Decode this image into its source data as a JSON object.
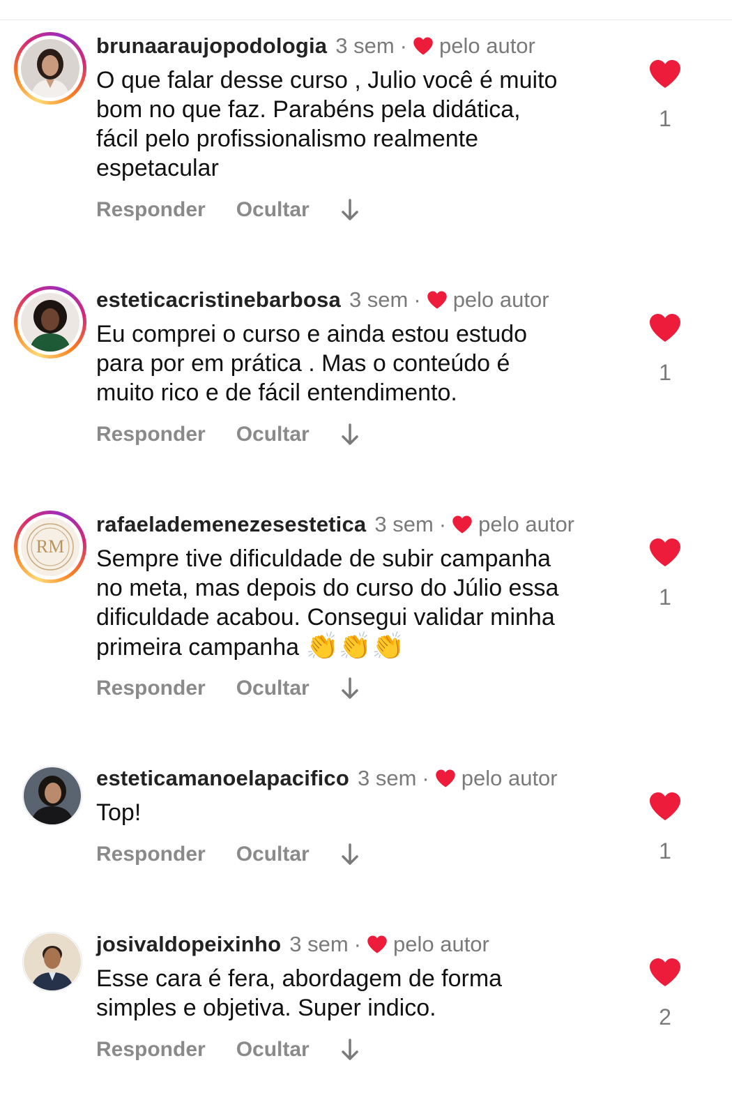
{
  "comments": [
    {
      "username": "brunaaraujopodologia",
      "time": "3 sem",
      "author_label": "pelo autor",
      "lines": [
        "O que falar desse curso , Julio você é muito",
        "bom no que faz. Parabéns pela didática,",
        "fácil pelo profissionalismo realmente",
        "espetacular"
      ],
      "likes": "1",
      "reply_label": "Responder",
      "hide_label": "Ocultar"
    },
    {
      "username": "esteticacristinebarbosa",
      "time": "3 sem",
      "author_label": "pelo autor",
      "lines": [
        "Eu comprei o curso e ainda estou estudo",
        "para por em prática . Mas o conteúdo é",
        "muito rico e de fácil entendimento."
      ],
      "likes": "1",
      "reply_label": "Responder",
      "hide_label": "Ocultar"
    },
    {
      "username": "rafaelademenezesestetica",
      "time": "3 sem",
      "author_label": "pelo autor",
      "lines": [
        "Sempre tive dificuldade de subir campanha",
        "no meta, mas depois do curso do Júlio essa",
        "dificuldade acabou. Consegui validar minha",
        "primeira campanha"
      ],
      "emoji": "👏👏👏",
      "likes": "1",
      "reply_label": "Responder",
      "hide_label": "Ocultar",
      "avatar_monogram": "RM"
    },
    {
      "username": "esteticamanoelapacifico",
      "time": "3 sem",
      "author_label": "pelo autor",
      "lines": [
        "Top!"
      ],
      "likes": "1",
      "reply_label": "Responder",
      "hide_label": "Ocultar"
    },
    {
      "username": "josivaldopeixinho",
      "time": "3 sem",
      "author_label": "pelo autor",
      "lines": [
        "Esse cara é fera, abordagem de forma",
        "simples e objetiva. Super indico."
      ],
      "likes": "2",
      "reply_label": "Responder",
      "hide_label": "Ocultar"
    }
  ],
  "colors": {
    "heart": "#ed1c3a",
    "muted": "#7a7a7a",
    "text": "#111111"
  },
  "icons": {
    "author_heart": "heart-icon",
    "like": "heart-icon",
    "expand": "arrow-down-icon"
  }
}
